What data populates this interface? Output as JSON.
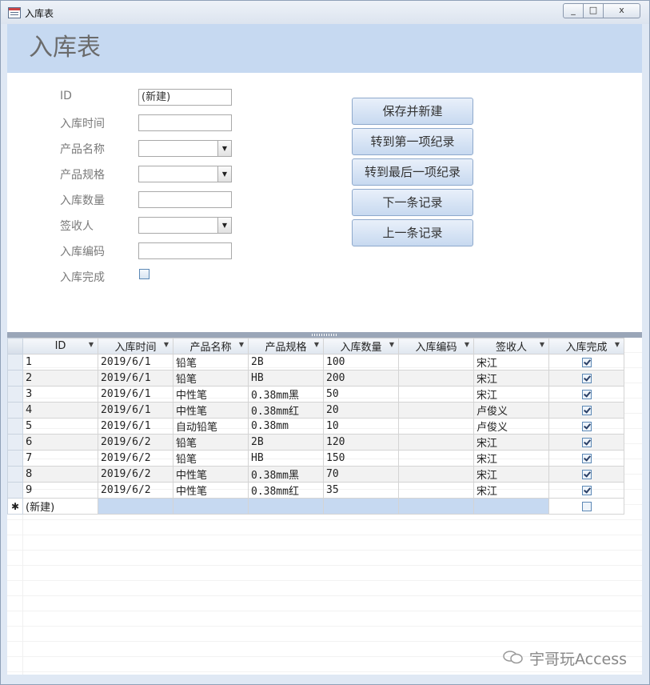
{
  "window": {
    "title": "入库表",
    "minimize": "_",
    "maximize": "□",
    "close": "x"
  },
  "form": {
    "header_title": "入库表",
    "labels": {
      "id": "ID",
      "time": "入库时间",
      "product": "产品名称",
      "spec": "产品规格",
      "qty": "入库数量",
      "signer": "签收人",
      "code": "入库编码",
      "done": "入库完成"
    },
    "values": {
      "id": "(新建)",
      "time": "",
      "product": "",
      "spec": "",
      "qty": "",
      "signer": "",
      "code": ""
    },
    "done_checked": false,
    "buttons": {
      "save_new": "保存并新建",
      "first": "转到第一项纪录",
      "last": "转到最后一项纪录",
      "next": "下一条记录",
      "prev": "上一条记录"
    }
  },
  "grid": {
    "columns": [
      "ID",
      "入库时间",
      "产品名称",
      "产品规格",
      "入库数量",
      "入库编码",
      "签收人",
      "入库完成"
    ],
    "rows": [
      {
        "id": "1",
        "time": "2019/6/1",
        "product": "铅笔",
        "spec": "2B",
        "qty": "100",
        "code": "",
        "signer": "宋江",
        "done": true
      },
      {
        "id": "2",
        "time": "2019/6/1",
        "product": "铅笔",
        "spec": "HB",
        "qty": "200",
        "code": "",
        "signer": "宋江",
        "done": true
      },
      {
        "id": "3",
        "time": "2019/6/1",
        "product": "中性笔",
        "spec": "0.38mm黑",
        "qty": "50",
        "code": "",
        "signer": "宋江",
        "done": true
      },
      {
        "id": "4",
        "time": "2019/6/1",
        "product": "中性笔",
        "spec": "0.38mm红",
        "qty": "20",
        "code": "",
        "signer": "卢俊义",
        "done": true
      },
      {
        "id": "5",
        "time": "2019/6/1",
        "product": "自动铅笔",
        "spec": "0.38mm",
        "qty": "10",
        "code": "",
        "signer": "卢俊义",
        "done": true
      },
      {
        "id": "6",
        "time": "2019/6/2",
        "product": "铅笔",
        "spec": "2B",
        "qty": "120",
        "code": "",
        "signer": "宋江",
        "done": true
      },
      {
        "id": "7",
        "time": "2019/6/2",
        "product": "铅笔",
        "spec": "HB",
        "qty": "150",
        "code": "",
        "signer": "宋江",
        "done": true
      },
      {
        "id": "8",
        "time": "2019/6/2",
        "product": "中性笔",
        "spec": "0.38mm黑",
        "qty": "70",
        "code": "",
        "signer": "宋江",
        "done": true
      },
      {
        "id": "9",
        "time": "2019/6/2",
        "product": "中性笔",
        "spec": "0.38mm红",
        "qty": "35",
        "code": "",
        "signer": "宋江",
        "done": true
      }
    ],
    "new_row": {
      "marker": "✱",
      "id": "(新建)"
    }
  },
  "watermark": "宇哥玩Access"
}
